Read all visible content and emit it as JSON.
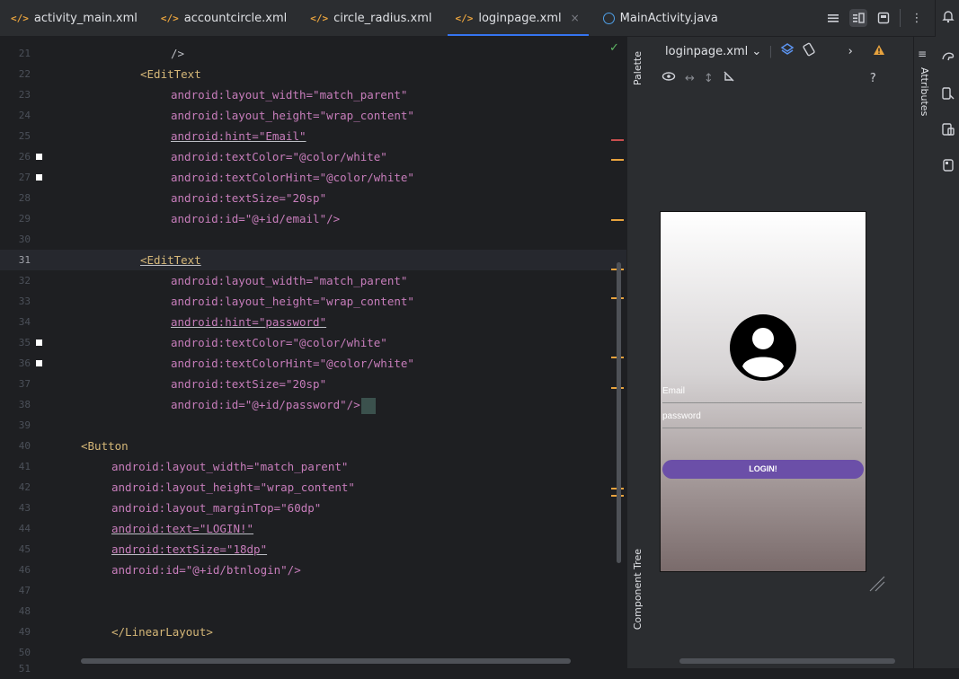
{
  "tabs": [
    {
      "icon": "</>",
      "label": "activity_main.xml",
      "active": false
    },
    {
      "icon": "</>",
      "label": "accountcircle.xml",
      "active": false
    },
    {
      "icon": "</>",
      "label": "circle_radius.xml",
      "active": false
    },
    {
      "icon": "</>",
      "label": "loginpage.xml",
      "active": true,
      "close": "×"
    },
    {
      "icon": "java",
      "label": "MainActivity.java",
      "active": false
    }
  ],
  "tab_tools": {
    "more": "⋮"
  },
  "editor": {
    "lines": [
      {
        "n": "21",
        "text": "/>"
      },
      {
        "n": "22",
        "text": "<EditText"
      },
      {
        "n": "23",
        "text": "android:layout_width=\"match_parent\""
      },
      {
        "n": "24",
        "text": "android:layout_height=\"wrap_content\""
      },
      {
        "n": "25",
        "text": "android:hint=\"Email\""
      },
      {
        "n": "26",
        "text": "android:textColor=\"@color/white\""
      },
      {
        "n": "27",
        "text": "android:textColorHint=\"@color/white\""
      },
      {
        "n": "28",
        "text": "android:textSize=\"20sp\""
      },
      {
        "n": "29",
        "text": "android:id=\"@+id/email\"/>"
      },
      {
        "n": "30",
        "text": ""
      },
      {
        "n": "31",
        "text": "<EditText"
      },
      {
        "n": "32",
        "text": "android:layout_width=\"match_parent\""
      },
      {
        "n": "33",
        "text": "android:layout_height=\"wrap_content\""
      },
      {
        "n": "34",
        "text": "android:hint=\"password\""
      },
      {
        "n": "35",
        "text": "android:textColor=\"@color/white\""
      },
      {
        "n": "36",
        "text": "android:textColorHint=\"@color/white\""
      },
      {
        "n": "37",
        "text": "android:textSize=\"20sp\""
      },
      {
        "n": "38",
        "text": "android:id=\"@+id/password\"/>"
      },
      {
        "n": "39",
        "text": ""
      },
      {
        "n": "40",
        "text": "<Button"
      },
      {
        "n": "41",
        "text": "android:layout_width=\"match_parent\""
      },
      {
        "n": "42",
        "text": "android:layout_height=\"wrap_content\""
      },
      {
        "n": "43",
        "text": "android:layout_marginTop=\"60dp\""
      },
      {
        "n": "44",
        "text": "android:text=\"LOGIN!\""
      },
      {
        "n": "45",
        "text": "android:textSize=\"18dp\""
      },
      {
        "n": "46",
        "text": "android:id=\"@+id/btnlogin\"/>"
      },
      {
        "n": "47",
        "text": ""
      },
      {
        "n": "48",
        "text": ""
      },
      {
        "n": "49",
        "text": "</LinearLayout>"
      },
      {
        "n": "50",
        "text": ""
      },
      {
        "n": "51",
        "text": ""
      }
    ],
    "current_line": "31"
  },
  "side_labels": {
    "palette": "Palette",
    "component_tree": "Component Tree",
    "attributes": "Attributes"
  },
  "design": {
    "file_selector": "loginpage.xml",
    "help": "?",
    "preview": {
      "email_hint": "Email",
      "password_hint": "password",
      "login_button": "LOGIN!",
      "button_color": "#6b4fa8"
    }
  },
  "colors": {
    "accent": "#3574f0",
    "tag": "#d5b778",
    "attribute": "#c77dbb",
    "string": "#6aab73",
    "warning": "#e8a33e"
  }
}
